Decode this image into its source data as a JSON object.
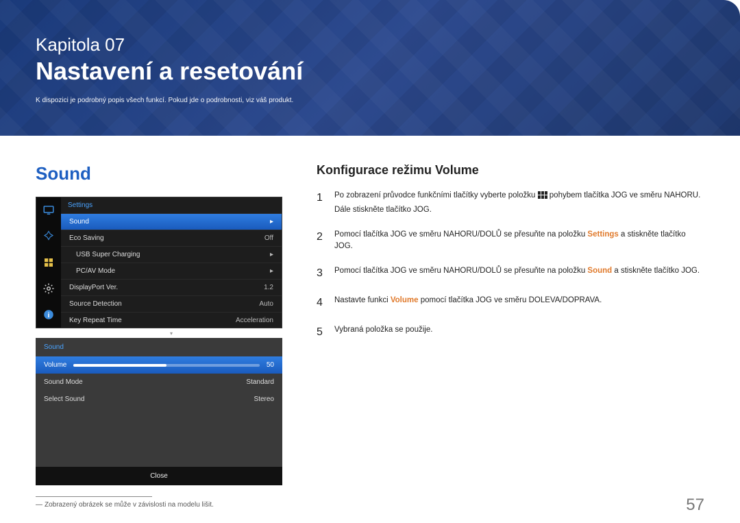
{
  "header": {
    "chapter": "Kapitola  07",
    "title": "Nastavení a resetování",
    "subhead": "K dispozici je podrobný popis všech funkcí. Pokud jde o podrobnosti, viz váš produkt."
  },
  "left": {
    "heading": "Sound",
    "osd1": {
      "sidebar_icons": [
        "monitor-icon",
        "picture-icon",
        "settings-icon",
        "gear-icon",
        "info-icon"
      ],
      "title": "Settings",
      "rows": [
        {
          "label": "Sound",
          "value": "▸",
          "selected": true,
          "indent": false
        },
        {
          "label": "Eco Saving",
          "value": "Off",
          "selected": false,
          "indent": false
        },
        {
          "label": "USB Super Charging",
          "value": "▸",
          "selected": false,
          "indent": true
        },
        {
          "label": "PC/AV Mode",
          "value": "▸",
          "selected": false,
          "indent": true
        },
        {
          "label": "DisplayPort Ver.",
          "value": "1.2",
          "selected": false,
          "indent": false
        },
        {
          "label": "Source Detection",
          "value": "Auto",
          "selected": false,
          "indent": false
        },
        {
          "label": "Key Repeat Time",
          "value": "Acceleration",
          "selected": false,
          "indent": false
        }
      ],
      "pager": "▾"
    },
    "osd2": {
      "title": "Sound",
      "rows": [
        {
          "label": "Volume",
          "value": "50",
          "selected": true,
          "slider": true
        },
        {
          "label": "Sound Mode",
          "value": "Standard",
          "selected": false,
          "slider": false
        },
        {
          "label": "Select Sound",
          "value": "Stereo",
          "selected": false,
          "slider": false
        }
      ],
      "close": "Close"
    },
    "footnote": "Zobrazený obrázek se může v závislosti na modelu lišit."
  },
  "right": {
    "heading": "Konfigurace režimu Volume",
    "steps": [
      {
        "n": "1",
        "pre": "Po zobrazení průvodce funkčními tlačítky vyberte položku ",
        "post": " pohybem tlačítka JOG ve směru NAHORU. Dále stiskněte tlačítko JOG.",
        "kw": "",
        "icon": true
      },
      {
        "n": "2",
        "pre": "Pomocí tlačítka JOG ve směru NAHORU/DOLŮ se přesuňte na položku ",
        "kw": "Settings",
        "post": " a stiskněte tlačítko JOG.",
        "icon": false
      },
      {
        "n": "3",
        "pre": "Pomocí tlačítka JOG ve směru NAHORU/DOLŮ se přesuňte na položku ",
        "kw": "Sound",
        "post": " a stiskněte tlačítko JOG.",
        "icon": false
      },
      {
        "n": "4",
        "pre": "Nastavte funkci ",
        "kw": "Volume",
        "post": " pomocí tlačítka JOG ve směru DOLEVA/DOPRAVA.",
        "icon": false
      },
      {
        "n": "5",
        "pre": "Vybraná položka se použije.",
        "kw": "",
        "post": "",
        "icon": false
      }
    ]
  },
  "page_number": "57"
}
